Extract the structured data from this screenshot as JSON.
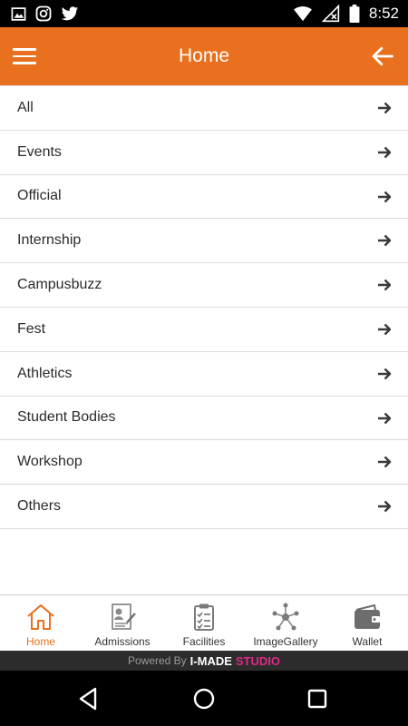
{
  "status_bar": {
    "time": "8:52",
    "left_icons": [
      "image-icon",
      "instagram-icon",
      "twitter-icon"
    ],
    "right_icons": [
      "wifi-icon",
      "signal-off-icon",
      "battery-icon"
    ]
  },
  "app_bar": {
    "title": "Home",
    "background": "#e8701e",
    "menu_icon": "hamburger-menu-icon",
    "back_icon": "arrow-left-icon"
  },
  "categories": [
    {
      "label": "All"
    },
    {
      "label": "Events"
    },
    {
      "label": "Official"
    },
    {
      "label": "Internship"
    },
    {
      "label": "Campusbuzz"
    },
    {
      "label": "Fest"
    },
    {
      "label": "Athletics"
    },
    {
      "label": "Student Bodies"
    },
    {
      "label": "Workshop"
    },
    {
      "label": "Others"
    }
  ],
  "bottom_nav": {
    "active": "Home",
    "accent": "#e8701e",
    "items": [
      {
        "label": "Home",
        "icon": "home-icon"
      },
      {
        "label": "Admissions",
        "icon": "admissions-icon"
      },
      {
        "label": "Facilities",
        "icon": "checklist-icon"
      },
      {
        "label": "ImageGallery",
        "icon": "network-icon"
      },
      {
        "label": "Wallet",
        "icon": "wallet-icon"
      }
    ]
  },
  "footer": {
    "powered_text": "Powered By",
    "brand_part1": "I-MADE",
    "brand_part2": "STUDIO"
  }
}
